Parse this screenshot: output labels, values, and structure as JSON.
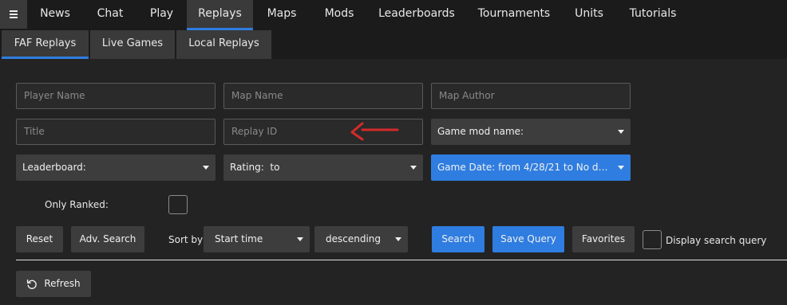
{
  "nav": {
    "tabs": [
      {
        "label": "News"
      },
      {
        "label": "Chat"
      },
      {
        "label": "Play"
      },
      {
        "label": "Replays"
      },
      {
        "label": "Maps"
      },
      {
        "label": "Mods"
      },
      {
        "label": "Leaderboards"
      },
      {
        "label": "Tournaments"
      },
      {
        "label": "Units"
      },
      {
        "label": "Tutorials"
      }
    ],
    "active": "Replays"
  },
  "subtabs": {
    "items": [
      {
        "label": "FAF Replays"
      },
      {
        "label": "Live Games"
      },
      {
        "label": "Local Replays"
      }
    ],
    "active": "FAF Replays"
  },
  "filters": {
    "player_name_placeholder": "Player Name",
    "map_name_placeholder": "Map Name",
    "map_author_placeholder": "Map Author",
    "title_placeholder": "Title",
    "replay_id_placeholder": "Replay ID",
    "game_mod_name": "Game mod name:",
    "leaderboard": "Leaderboard:",
    "rating": "Rating:  to",
    "game_date": "Game Date: from 4/28/21 to No date a...",
    "only_ranked_label": "Only Ranked:"
  },
  "actions": {
    "reset": "Reset",
    "adv_search": "Adv. Search",
    "sort_by_label": "Sort by",
    "sort_field": "Start time",
    "sort_order": "descending",
    "search": "Search",
    "save_query": "Save Query",
    "favorites": "Favorites",
    "display_search_query": "Display search query",
    "refresh": "Refresh"
  },
  "colors": {
    "accent": "#2f7de0",
    "annotation": "#d42a2a"
  }
}
